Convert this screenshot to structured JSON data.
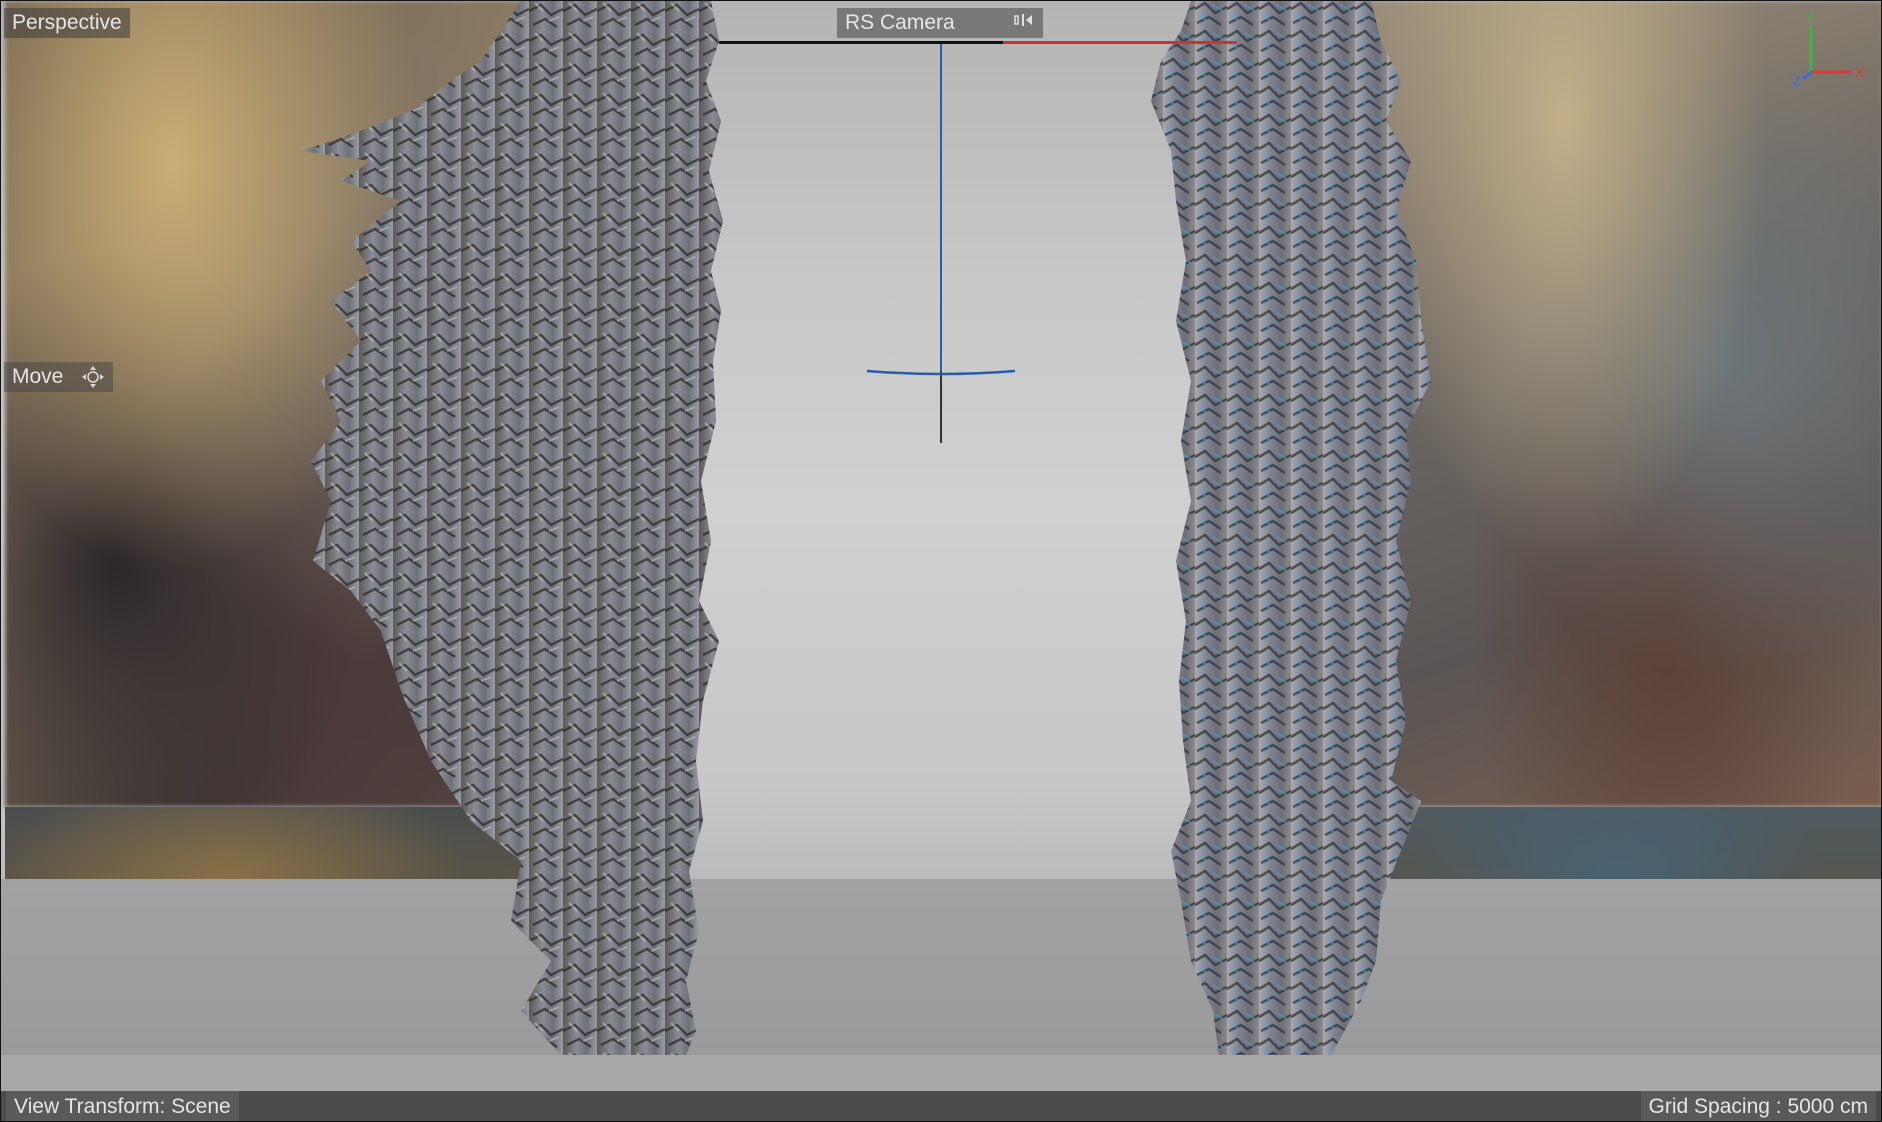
{
  "viewport": {
    "title": "Perspective",
    "camera_name": "RS Camera",
    "camera_icon": "camera-lock-icon",
    "active_tool": "Move",
    "active_tool_icon": "move-icon"
  },
  "status_bar": {
    "view_transform": "View Transform: Scene",
    "grid_spacing": "Grid Spacing : 5000 cm"
  },
  "axis_gizmo": {
    "x_label": "X",
    "y_label": "Y",
    "z_label": "Z",
    "colors": {
      "x": "#d23b3b",
      "y": "#3bb54a",
      "z": "#3b6fd2"
    }
  },
  "colors": {
    "viewport_bg": "#c8c8c8",
    "floor": "#a0a0a0",
    "camera_gizmo": "#2a5ca8",
    "rock_mesh": "#7a7e86"
  }
}
